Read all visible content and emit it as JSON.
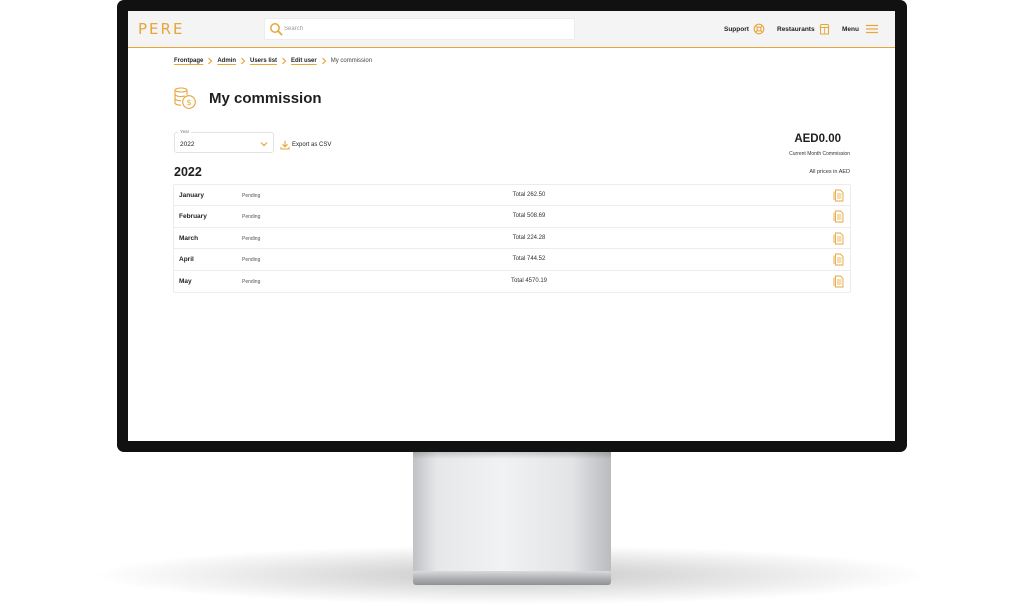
{
  "header": {
    "logo_text": "PERE",
    "search_placeholder": "Search",
    "support_label": "Support",
    "restaurants_label": "Restaurants",
    "menu_label": "Menu"
  },
  "breadcrumb": {
    "items": [
      "Frontpage",
      "Admin",
      "Users list",
      "Edit user"
    ],
    "current": "My commission"
  },
  "page": {
    "title": "My commission",
    "year_select_label": "Year",
    "year_select_value": "2022",
    "export_label": "Export as CSV",
    "current_month_amount": "AED0.00",
    "current_month_label": "Current Month Commission",
    "year_heading": "2022",
    "price_note": "All prices in AED"
  },
  "months": [
    {
      "name": "January",
      "status": "Pending",
      "total": "Total 262.50"
    },
    {
      "name": "February",
      "status": "Pending",
      "total": "Total 508.69"
    },
    {
      "name": "March",
      "status": "Pending",
      "total": "Total 224.28"
    },
    {
      "name": "April",
      "status": "Pending",
      "total": "Total 744.52"
    },
    {
      "name": "May",
      "status": "Pending",
      "total": "Total 4570.19"
    }
  ],
  "colors": {
    "accent": "#e7a53a",
    "header_bg": "#f4f4f4",
    "text": "#1e1e1e"
  },
  "icons": {
    "search": "search-icon",
    "support": "lifebuoy-icon",
    "restaurants": "store-icon",
    "menu": "hamburger-icon",
    "title": "coins-icon",
    "export": "download-icon",
    "invoice": "invoice-icon",
    "select": "chevron-down-icon",
    "breadcrumb_separator": "chevron-right-icon"
  }
}
